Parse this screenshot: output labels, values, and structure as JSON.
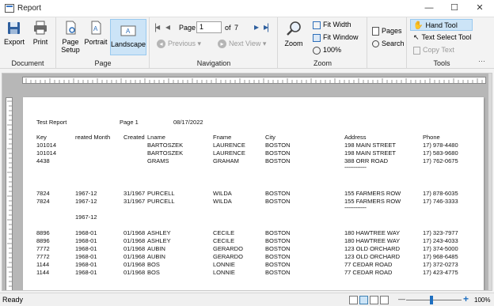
{
  "window": {
    "title": "Report",
    "minimize_glyph": "—",
    "maximize_glyph": "☐",
    "close_glyph": "✕"
  },
  "ribbon": {
    "document": {
      "label": "Document",
      "export": "Export",
      "print": "Print"
    },
    "page": {
      "label": "Page",
      "page_setup": "Page\nSetup",
      "page_setup_l1": "Page",
      "page_setup_l2": "Setup",
      "portrait": "Portrait",
      "landscape": "Landscape"
    },
    "navigation": {
      "label": "Navigation",
      "page_label": "Page",
      "page_value": "1",
      "of_label": "of",
      "total_pages": "7",
      "previous": "Previous",
      "next_view": "Next View"
    },
    "zoom": {
      "label": "Zoom",
      "zoom": "Zoom",
      "fit_width": "Fit Width",
      "fit_window": "Fit Window",
      "percent": "100%"
    },
    "misc": {
      "pages": "Pages",
      "search": "Search"
    },
    "tools": {
      "label": "Tools",
      "hand_tool": "Hand Tool",
      "text_select_tool": "Text Select Tool",
      "copy_text": "Copy Text"
    },
    "more_glyph": "···"
  },
  "report": {
    "header": {
      "title": "Test Report",
      "page": "Page 1",
      "date": "08/17/2022"
    },
    "columns": [
      "Key",
      "reated Month",
      "Created",
      "Lname",
      "Fname",
      "City",
      "Address",
      "Phone"
    ],
    "rows": [
      [
        "101014",
        "",
        "",
        "BARTOSZEK",
        "LAURENCE",
        "BOSTON",
        "198 MAIN STREET",
        "17) 978-4480"
      ],
      [
        "101014",
        "",
        "",
        "BARTOSZEK",
        "LAURENCE",
        "BOSTON",
        "198 MAIN STREET",
        "17) 583-9680"
      ],
      [
        "4438",
        "",
        "",
        "GRAMS",
        "GRAHAM",
        "BOSTON",
        "388 ORR ROAD",
        "17) 762-0675"
      ],
      [
        "",
        "",
        "",
        "",
        "",
        "",
        "---------------",
        ""
      ],
      [
        "7824",
        "1967-12",
        "31/1967",
        "PURCELL",
        "WILDA",
        "BOSTON",
        "155 FARMERS ROW",
        "17) 878-6035"
      ],
      [
        "7824",
        "1967-12",
        "31/1967",
        "PURCELL",
        "WILDA",
        "BOSTON",
        "155 FARMERS ROW",
        "17) 746-3333"
      ],
      [
        "",
        "",
        "",
        "",
        "",
        "",
        "---------------",
        ""
      ],
      [
        "",
        "1967-12",
        "",
        "",
        "",
        "",
        "",
        ""
      ],
      [
        "8896",
        "1968-01",
        "01/1968",
        "ASHLEY",
        "CECILE",
        "BOSTON",
        "180 HAWTREE WAY",
        "17) 323-7977"
      ],
      [
        "8896",
        "1968-01",
        "01/1968",
        "ASHLEY",
        "CECILE",
        "BOSTON",
        "180 HAWTREE WAY",
        "17) 243-4033"
      ],
      [
        "7772",
        "1968-01",
        "01/1968",
        "AUBIN",
        "GERARDO",
        "BOSTON",
        "123 OLD ORCHARD",
        "17) 374-5000"
      ],
      [
        "7772",
        "1968-01",
        "01/1968",
        "AUBIN",
        "GERARDO",
        "BOSTON",
        "123 OLD ORCHARD",
        "17) 968-6485"
      ],
      [
        "1144",
        "1968-01",
        "01/1968",
        "BOS",
        "LONNIE",
        "BOSTON",
        "77 CEDAR ROAD",
        "17) 372-0273"
      ],
      [
        "1144",
        "1968-01",
        "01/1968",
        "BOS",
        "LONNIE",
        "BOSTON",
        "77 CEDAR ROAD",
        "17) 423-4775"
      ]
    ]
  },
  "statusbar": {
    "status": "Ready",
    "zoom": "100%",
    "zoom_minus": "—",
    "zoom_plus": "+",
    "zoom_fraction": 0.45
  },
  "colors": {
    "accent": "#1e6fc0",
    "active_bg": "#cce4f7",
    "active_border": "#99c9ef"
  }
}
